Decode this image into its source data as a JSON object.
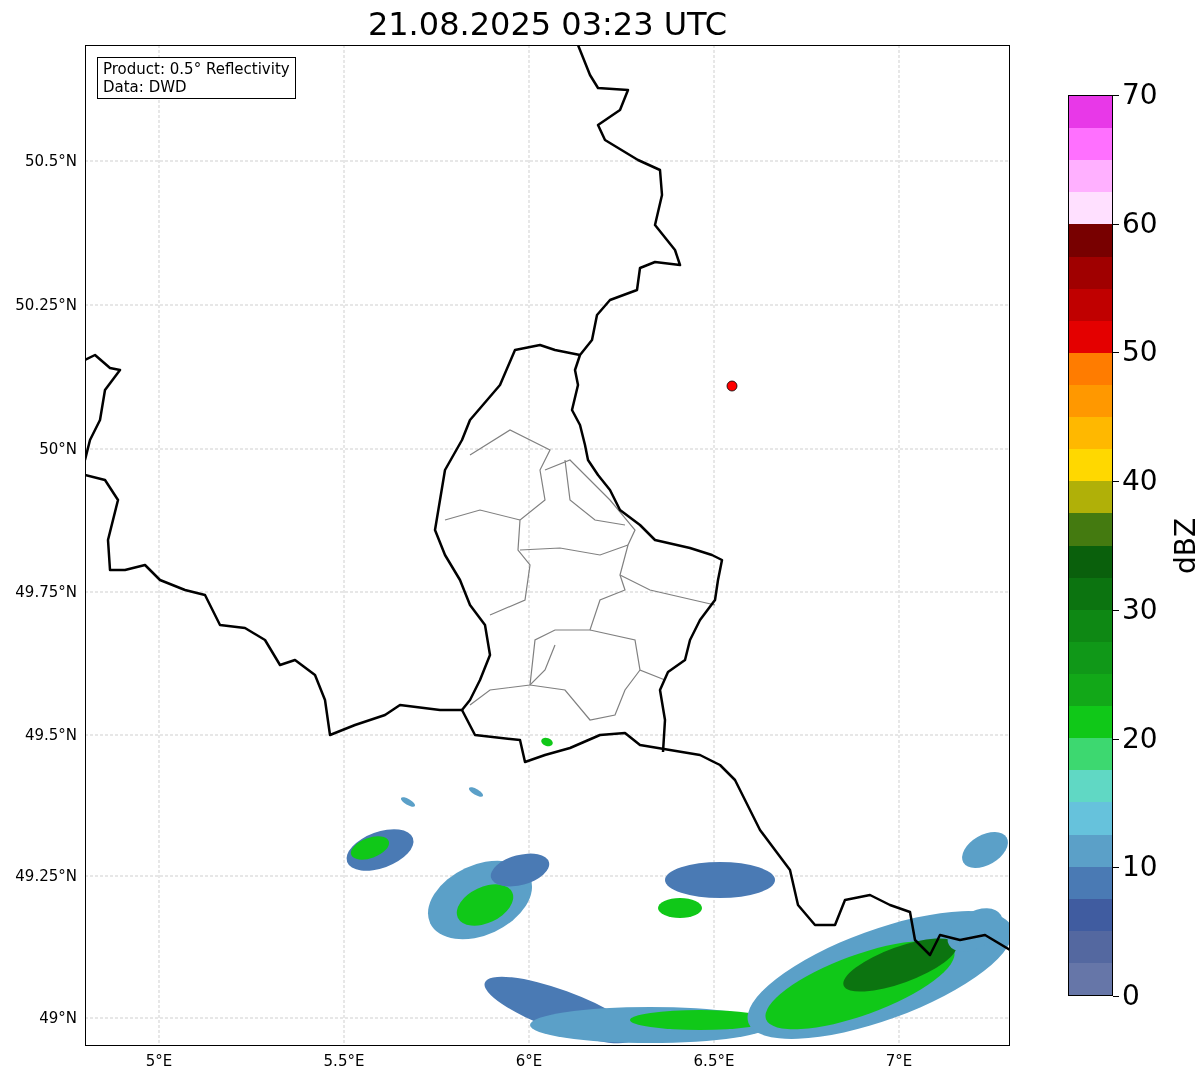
{
  "title": "21.08.2025 03:23 UTC",
  "info_box": [
    "Product: 0.5° Reflectivity",
    "Data: DWD"
  ],
  "map": {
    "y_ticks": [
      "50.5°N",
      "50.25°N",
      "50°N",
      "49.75°N",
      "49.5°N",
      "49.25°N",
      "49°N"
    ],
    "x_ticks": [
      "5°E",
      "5.5°E",
      "6°E",
      "6.5°E",
      "7°E"
    ],
    "marker": {
      "color": "#ff0000"
    }
  },
  "colorbar": {
    "label": "dBZ",
    "ticks": [
      "70",
      "60",
      "50",
      "40",
      "30",
      "20",
      "10",
      "0"
    ],
    "bands": [
      {
        "color": "#e838e8"
      },
      {
        "color": "#ff70ff"
      },
      {
        "color": "#ffb0ff"
      },
      {
        "color": "#ffe0ff"
      },
      {
        "color": "#780000"
      },
      {
        "color": "#a00000"
      },
      {
        "color": "#c00000"
      },
      {
        "color": "#e40000"
      },
      {
        "color": "#ff7c00"
      },
      {
        "color": "#ff9800"
      },
      {
        "color": "#ffb800"
      },
      {
        "color": "#ffd800"
      },
      {
        "color": "#b0b008"
      },
      {
        "color": "#447a10"
      },
      {
        "color": "#0a600c"
      },
      {
        "color": "#0c7410"
      },
      {
        "color": "#0e8814"
      },
      {
        "color": "#109818"
      },
      {
        "color": "#12a818"
      },
      {
        "color": "#10c818"
      },
      {
        "color": "#3dd870"
      },
      {
        "color": "#60d8c4"
      },
      {
        "color": "#66c2dc"
      },
      {
        "color": "#5ba0c8"
      },
      {
        "color": "#4a7ab4"
      },
      {
        "color": "#405ca0"
      },
      {
        "color": "#5468a0"
      },
      {
        "color": "#6676a8"
      }
    ]
  }
}
